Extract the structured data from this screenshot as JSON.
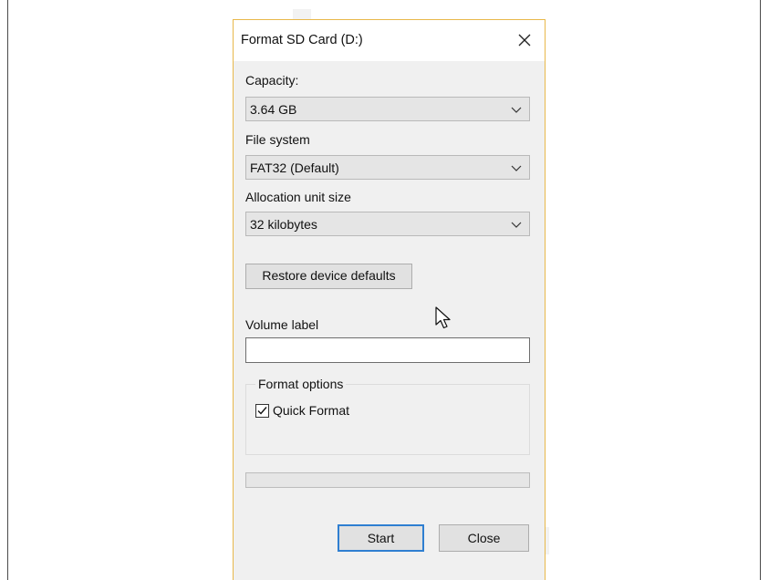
{
  "dialog": {
    "title": "Format SD Card (D:)",
    "capacity": {
      "label": "Capacity:",
      "value": "3.64 GB"
    },
    "file_system": {
      "label": "File system",
      "value": "FAT32 (Default)"
    },
    "allocation": {
      "label": "Allocation unit size",
      "value": "32 kilobytes"
    },
    "restore_button": "Restore device defaults",
    "volume_label": {
      "label": "Volume label",
      "value": ""
    },
    "format_options": {
      "legend": "Format options",
      "quick_format": {
        "label": "Quick Format",
        "checked": true
      }
    },
    "progress": {
      "value": 0
    },
    "start_button": "Start",
    "close_button": "Close"
  },
  "colors": {
    "accent_border": "#e8b84a",
    "primary_button_border": "#2f7fd1",
    "dialog_bg": "#f0f0f0"
  },
  "icons": [
    "close-icon",
    "chevron-down-icon",
    "checkmark-icon",
    "mouse-pointer-icon"
  ]
}
